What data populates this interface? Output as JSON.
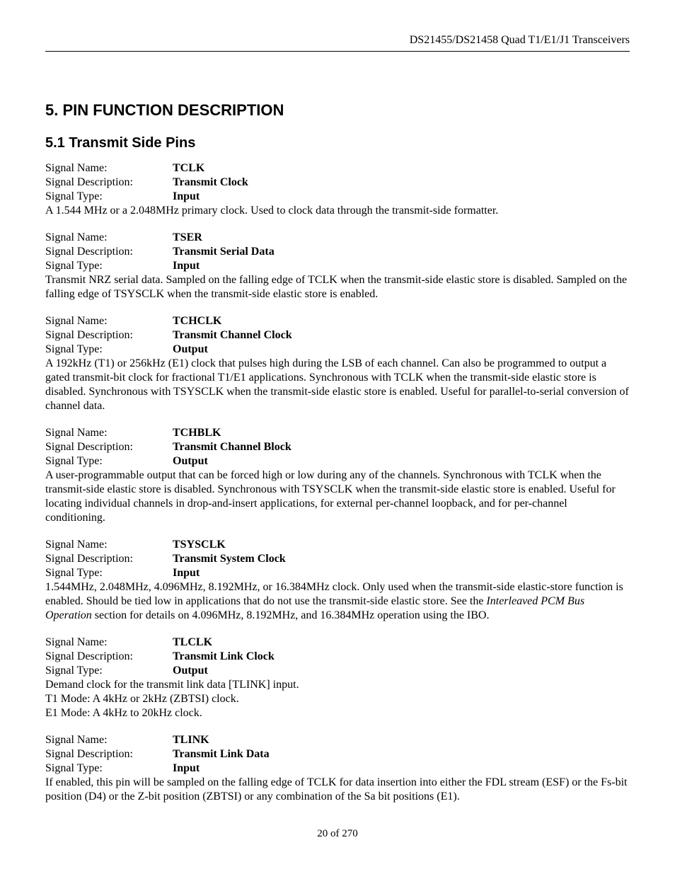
{
  "header": {
    "doc_title": "DS21455/DS21458 Quad T1/E1/J1 Transceivers"
  },
  "section": {
    "number": "5.",
    "title": "PIN FUNCTION DESCRIPTION"
  },
  "subsection": {
    "number": "5.1",
    "title": "Transmit Side Pins"
  },
  "labels": {
    "signal_name": "Signal Name:",
    "signal_description": "Signal Description:",
    "signal_type": "Signal Type:"
  },
  "pins": [
    {
      "name": "TCLK",
      "description": "Transmit Clock",
      "type": "Input",
      "text_segments": [
        {
          "t": "A 1.544 MHz or a 2.048MHz primary clock. Used to clock data through the transmit-side formatter."
        }
      ]
    },
    {
      "name": "TSER",
      "description": "Transmit Serial Data",
      "type": "Input",
      "text_segments": [
        {
          "t": "Transmit NRZ serial data. Sampled on the falling edge of TCLK when the transmit-side elastic store is disabled. Sampled on the falling edge of TSYSCLK when the transmit-side elastic store is enabled."
        }
      ]
    },
    {
      "name": "TCHCLK",
      "description": "Transmit Channel Clock",
      "type": "Output",
      "text_segments": [
        {
          "t": "A 192kHz (T1) or 256kHz (E1) clock that pulses high during the LSB of each channel. Can also be programmed to output a gated transmit-bit clock for fractional T1/E1 applications. Synchronous with TCLK when the transmit-side elastic store is disabled. Synchronous with TSYSCLK when the transmit-side elastic store is enabled. Useful for parallel-to-serial conversion of channel data."
        }
      ]
    },
    {
      "name": "TCHBLK",
      "description": "Transmit Channel Block",
      "type": "Output",
      "text_segments": [
        {
          "t": "A user-programmable output that can be forced high or low during any of the channels. Synchronous with TCLK when the transmit-side elastic store is disabled. Synchronous with TSYSCLK when the transmit-side elastic store is enabled. Useful for locating individual channels in drop-and-insert applications, for external per-channel loopback, and for per-channel conditioning."
        }
      ]
    },
    {
      "name": "TSYSCLK",
      "description": "Transmit System Clock",
      "type": "Input",
      "text_segments": [
        {
          "t": "1.544MHz, 2.048MHz, 4.096MHz, 8.192MHz, or 16.384MHz clock. Only used when the transmit-side elastic-store function is enabled. Should be tied low in applications that do not use the transmit-side elastic store. See the "
        },
        {
          "t": "Interleaved PCM Bus Operation",
          "italic": true
        },
        {
          "t": " section for details on 4.096MHz, 8.192MHz, and 16.384MHz operation using the IBO."
        }
      ]
    },
    {
      "name": "TLCLK",
      "description": "Transmit Link Clock",
      "type": "Output",
      "text_segments": [
        {
          "t": "Demand clock for the transmit link data [TLINK] input."
        },
        {
          "br": true
        },
        {
          "t": "T1 Mode: A 4kHz or 2kHz (ZBTSI) clock."
        },
        {
          "br": true
        },
        {
          "t": "E1 Mode: A 4kHz to 20kHz clock."
        }
      ]
    },
    {
      "name": "TLINK",
      "description": "Transmit Link Data",
      "type": "Input",
      "text_segments": [
        {
          "t": "If enabled, this pin will be sampled on the falling edge of TCLK for data insertion into either the FDL stream (ESF) or the Fs-bit position (D4) or the Z-bit position (ZBTSI) or any combination of the Sa bit positions (E1)."
        }
      ]
    }
  ],
  "footer": {
    "page": "20 of 270"
  }
}
